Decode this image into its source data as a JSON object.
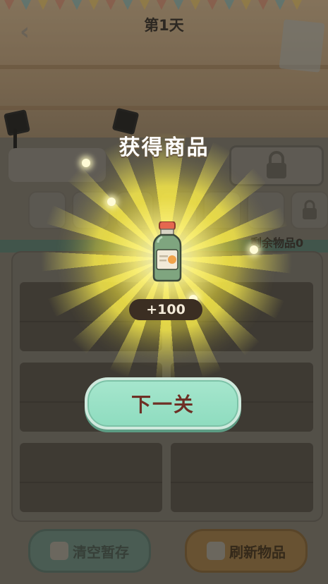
{
  "header": {
    "back_icon": "chevron-left-icon",
    "day_title": "第1天"
  },
  "status": {
    "remaining_items": "剩余物品0"
  },
  "reward_popup": {
    "title": "获得商品",
    "item_icon": "bottle-icon",
    "amount": "+100",
    "next_button": "下一关"
  },
  "bottom_bar": {
    "clear_storage": "清空暂存",
    "refresh_items": "刷新物品"
  },
  "colors": {
    "next_button": "#9be2c6",
    "next_text": "#6e2f25",
    "amount_pill": "#3b2e22",
    "glow": "#f6e63c"
  }
}
